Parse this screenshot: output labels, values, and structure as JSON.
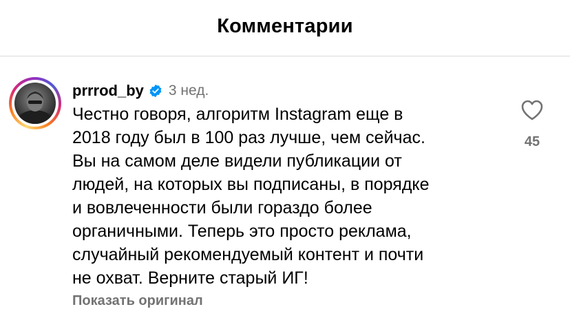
{
  "header": {
    "title": "Комментарии"
  },
  "comment": {
    "username": "prrrod_by",
    "verified": true,
    "timestamp": "3 нед.",
    "text": "Честно говоря, алгоритм Instagram еще в\n2018 году был в 100 раз лучше, чем сейчас.\nВы на самом деле видели публикации от\nлюдей, на которых вы подписаны, в порядке\nи вовлеченности были гораздо более\nорганичными. Теперь это просто реклама,\nслучайный рекомендуемый контент и почти\nне охват. Верните старый ИГ!",
    "translate_label": "Показать оригинал",
    "like_count": "45",
    "icons": {
      "like": "heart-outline-icon",
      "verified": "verified-badge-icon"
    }
  },
  "colors": {
    "secondary_text": "#737373",
    "verified_blue": "#0095f6",
    "divider": "#dbdbdb"
  }
}
